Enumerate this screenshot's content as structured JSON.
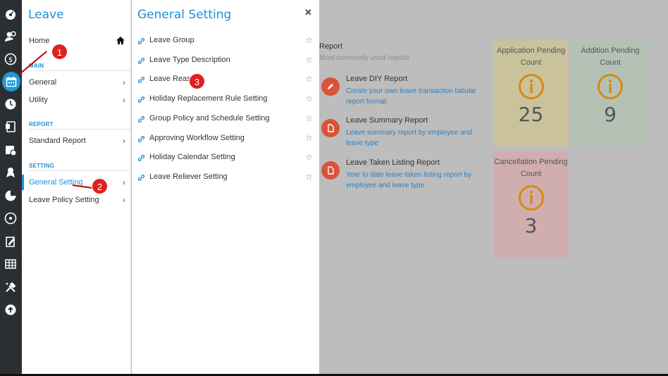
{
  "leave_panel": {
    "title": "Leave",
    "home_label": "Home",
    "sections": {
      "main": "MAIN",
      "report": "REPORT",
      "setting": "SETTING"
    },
    "items": {
      "general": "General",
      "utility": "Utility",
      "standard_report": "Standard Report",
      "general_setting": "General Setting",
      "leave_policy_setting": "Leave Policy Setting"
    }
  },
  "general_setting_panel": {
    "title": "General Setting",
    "items": [
      "Leave Group",
      "Leave Type Description",
      "Leave Reason",
      "Holiday Replacement Rule Setting",
      "Group Policy and Schedule Setting",
      "Approving Workflow Setting",
      "Holiday Calendar Setting",
      "Leave Reliever Setting"
    ]
  },
  "report": {
    "title": "Report",
    "subtitle": "Most commonly used reports",
    "items": [
      {
        "name": "Leave DIY Report",
        "desc": "Create your own leave transaction tabular report format"
      },
      {
        "name": "Leave Summary Report",
        "desc": "Leave summary report by employee and leave type"
      },
      {
        "name": "Leave Taken Listing Report",
        "desc": "Year to date leave taken listing report by employee and leave type"
      }
    ]
  },
  "cards": [
    {
      "label": "Application Pending Count",
      "count": "25",
      "bg": "#c9c29c",
      "accent": "#d68a12"
    },
    {
      "label": "Addition Pending Count",
      "count": "9",
      "bg": "#b3c2b4",
      "accent": "#d68a12"
    },
    {
      "label": "Cancellation Pending Count",
      "count": "3",
      "bg": "#d0aeb0",
      "accent": "#d68a12"
    }
  ],
  "badges": [
    "1",
    "2",
    "3"
  ],
  "colors": {
    "accent": "#1f8fd6",
    "rail": "#2b2f33",
    "badge": "#e01f1f",
    "report_icon": "#d9533a"
  }
}
